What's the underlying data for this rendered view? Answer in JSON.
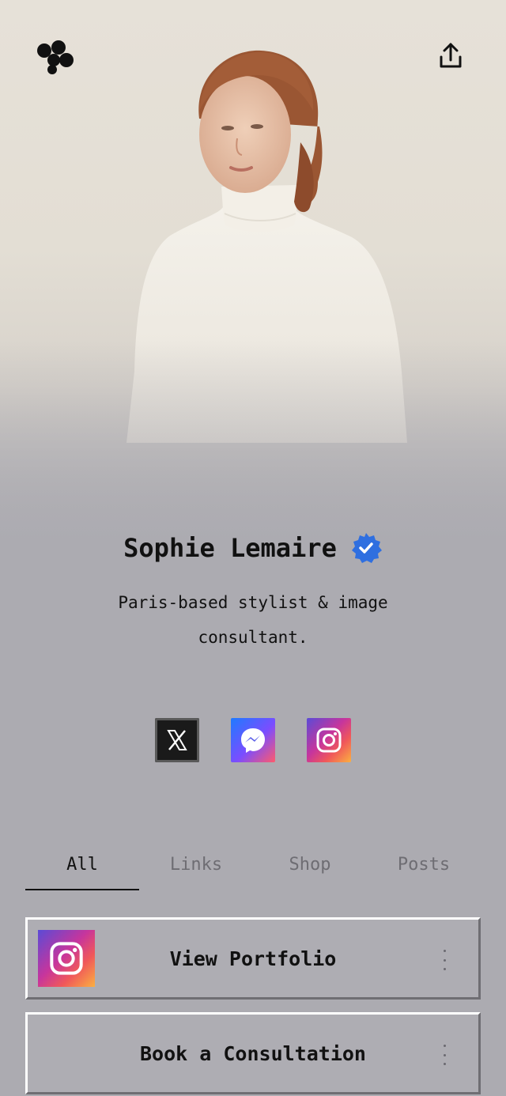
{
  "profile": {
    "name": "Sophie Lemaire",
    "bio": "Paris-based stylist & image consultant.",
    "verified": true
  },
  "header": {
    "logo_icon": "linktree-blob-icon",
    "share_icon": "share-upload-icon"
  },
  "hero": {
    "image": "portrait-woman-white-turtleneck"
  },
  "socials": [
    {
      "name": "X",
      "icon": "x-icon"
    },
    {
      "name": "Messenger",
      "icon": "messenger-icon"
    },
    {
      "name": "Instagram",
      "icon": "instagram-icon"
    }
  ],
  "tabs": [
    {
      "label": "All",
      "active": true
    },
    {
      "label": "Links",
      "active": false
    },
    {
      "label": "Shop",
      "active": false
    },
    {
      "label": "Posts",
      "active": false
    }
  ],
  "links": [
    {
      "label": "View Portfolio",
      "thumb_icon": "instagram-icon"
    },
    {
      "label": "Book a Consultation",
      "thumb_icon": ""
    }
  ],
  "colors": {
    "background": "#acabb1",
    "verified_badge": "#2f6fe0",
    "text": "#111111",
    "tab_inactive": "#6e6d73"
  }
}
